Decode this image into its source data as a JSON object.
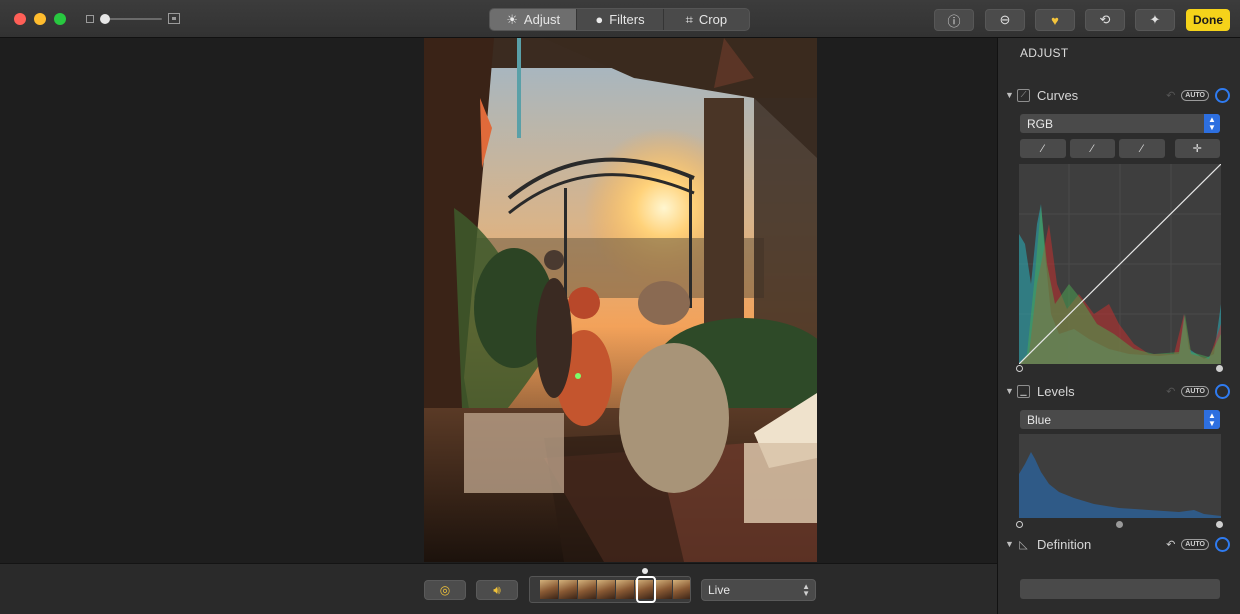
{
  "toolbar": {
    "tabs": [
      {
        "label": "Adjust",
        "icon": "sun-icon",
        "selected": true
      },
      {
        "label": "Filters",
        "icon": "filters-icon",
        "selected": false
      },
      {
        "label": "Crop",
        "icon": "crop-icon",
        "selected": false
      }
    ],
    "buttons": [
      {
        "name": "info",
        "icon": "info-icon"
      },
      {
        "name": "hide",
        "icon": "minus-circle-icon"
      },
      {
        "name": "favorite",
        "icon": "heart-icon"
      },
      {
        "name": "rotate",
        "icon": "rotate-icon"
      },
      {
        "name": "enhance",
        "icon": "magic-wand-icon"
      }
    ],
    "done_label": "Done"
  },
  "live_bar": {
    "ring_icon": "live-photo-icon",
    "sound_icon": "speaker-icon",
    "mode": "Live"
  },
  "panel": {
    "title": "ADJUST",
    "curves": {
      "label": "Curves",
      "auto_label": "AUTO",
      "channel": "RGB"
    },
    "levels": {
      "label": "Levels",
      "auto_label": "AUTO",
      "channel": "Blue"
    },
    "definition": {
      "label": "Definition",
      "auto_label": "AUTO"
    }
  },
  "colors": {
    "accent": "#2f7bf0",
    "done": "#f5d31a",
    "favorite": "#f4c43b"
  }
}
